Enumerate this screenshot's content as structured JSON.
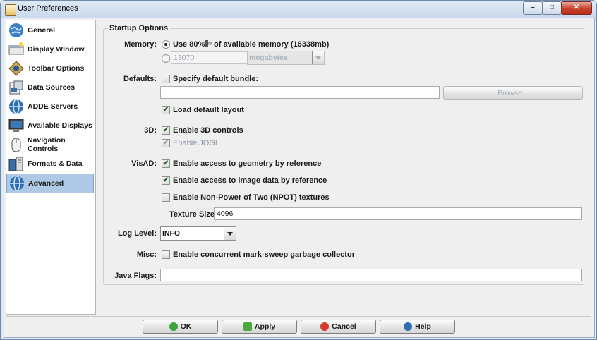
{
  "window": {
    "title": "User Preferences",
    "minimize": "–",
    "maximize": "□",
    "close": "✕"
  },
  "sidebar": {
    "items": [
      {
        "label": "General",
        "icon": "globe-icon"
      },
      {
        "label": "Display Window",
        "icon": "window-icon"
      },
      {
        "label": "Toolbar Options",
        "icon": "toolbar-icon"
      },
      {
        "label": "Data Sources",
        "icon": "data-icon"
      },
      {
        "label": "ADDE Servers",
        "icon": "server-icon"
      },
      {
        "label": "Available Displays",
        "icon": "monitor-icon"
      },
      {
        "label": "Navigation Controls",
        "icon": "mouse-icon"
      },
      {
        "label": "Formats & Data",
        "icon": "formats-icon"
      },
      {
        "label": "Advanced",
        "icon": "globe-icon",
        "selected": true
      }
    ]
  },
  "startup": {
    "legend": "Startup Options",
    "memory_label": "Memory:",
    "memory_percent_label": "Use 80%",
    "memory_percent_suffix": "of available memory (16338mb)",
    "memory_value": "13070",
    "memory_unit": "megabytes",
    "defaults_label": "Defaults:",
    "specify_bundle": "Specify default bundle:",
    "bundle_path": "",
    "browse": "Browse...",
    "load_default_layout": "Load default layout",
    "threed_label": "3D:",
    "enable_3d": "Enable 3D controls",
    "enable_jogl": "Enable JOGL",
    "visad_label": "VisAD:",
    "geometry_ref": "Enable access to geometry by reference",
    "image_ref": "Enable access to image data by reference",
    "npot": "Enable Non-Power of Two (NPOT) textures",
    "texture_label": "Texture Size:",
    "texture_value": "4096",
    "loglevel_label": "Log Level:",
    "loglevel_value": "INFO",
    "misc_label": "Misc:",
    "gc": "Enable concurrent mark-sweep garbage collector",
    "javaflags_label": "Java Flags:",
    "javaflags_value": ""
  },
  "footer": {
    "ok": "OK",
    "apply": "Apply",
    "cancel": "Cancel",
    "help": "Help"
  }
}
